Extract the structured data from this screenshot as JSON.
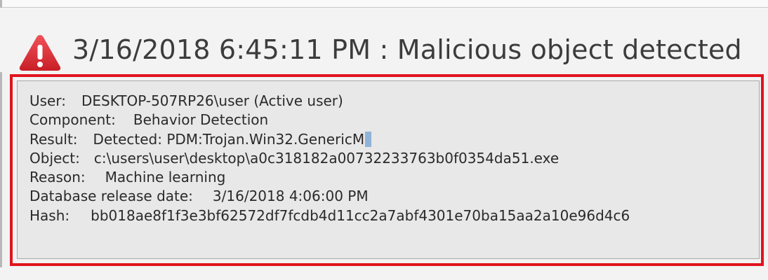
{
  "header": {
    "title": "3/16/2018 6:45:11 PM : Malicious object detected"
  },
  "details": {
    "user": {
      "label": "User:",
      "value": "DESKTOP-507RP26\\user (Active user)"
    },
    "component": {
      "label": "Component:",
      "value": "Behavior Detection"
    },
    "result": {
      "label": "Result:",
      "value": "Detected: PDM:Trojan.Win32.GenericM"
    },
    "object": {
      "label": "Object:",
      "value": "c:\\users\\user\\desktop\\a0c318182a00732233763b0f0354da51.exe"
    },
    "reason": {
      "label": "Reason:",
      "value": "Machine learning"
    },
    "db_date": {
      "label": "Database release date:",
      "value": "3/16/2018 4:06:00 PM"
    },
    "hash": {
      "label": "Hash:",
      "value": "bb018ae8f1f3e3bf62572df7fcdb4d11cc2a7abf4301e70ba15aa2a10e96d4c6"
    }
  },
  "colors": {
    "highlight": "#e0141e",
    "warning": "#d9262a",
    "selection": "#8fb4d8"
  },
  "icons": {
    "header_icon": "warning-triangle-icon"
  }
}
